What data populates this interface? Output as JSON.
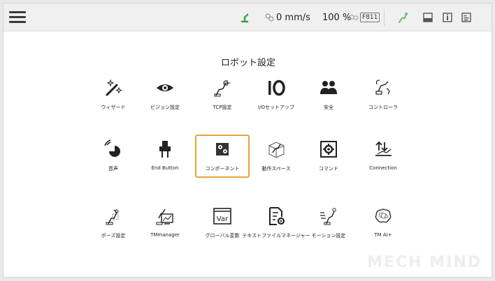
{
  "header": {
    "speed": "0 mm/s",
    "percent": "100 %",
    "f_badge": "F811",
    "icons": [
      "robot-arm-status-icon",
      "speed-gear-icon",
      "link-icon",
      "arm-mode-icon",
      "window-icon",
      "info-icon",
      "log-icon"
    ],
    "colors": {
      "status_green": "#3aa33a",
      "topbar_bg": "#f0f0f0"
    }
  },
  "page": {
    "title": "ロボット設定"
  },
  "grid": {
    "rows": [
      [
        {
          "label": "ウィザード",
          "icon": "wand-icon"
        },
        {
          "label": "ビジョン設定",
          "icon": "eye-icon"
        },
        {
          "label": "TCP設定",
          "icon": "tcp-icon"
        },
        {
          "label": "I/Oセットアップ",
          "icon": "io-icon"
        },
        {
          "label": "安全",
          "icon": "safety-people-icon"
        },
        {
          "label": "コントローラ",
          "icon": "controller-icon"
        }
      ],
      [
        {
          "label": "音声",
          "icon": "speaker-icon"
        },
        {
          "label": "End Button",
          "icon": "gripper-icon"
        },
        {
          "label": "コンポーネント",
          "icon": "component-icon",
          "selected": true
        },
        {
          "label": "動作スペース",
          "icon": "workspace-icon"
        },
        {
          "label": "コマンド",
          "icon": "command-icon"
        },
        {
          "label": "Connection",
          "icon": "connection-icon"
        }
      ],
      [
        {
          "label": "ポーズ設定",
          "icon": "pose-icon"
        },
        {
          "label": "TMmanager",
          "icon": "tmmanager-icon"
        },
        {
          "label": "グローバル変数",
          "icon": "var-icon"
        },
        {
          "label": "テキストファイルマネージャー",
          "icon": "text-file-icon"
        },
        {
          "label": "モーション設定",
          "icon": "motion-icon"
        },
        {
          "label": "TM AI+",
          "icon": "ai-brain-icon"
        }
      ]
    ],
    "accent": "#e8a23c"
  },
  "watermark": "MECH MIND"
}
